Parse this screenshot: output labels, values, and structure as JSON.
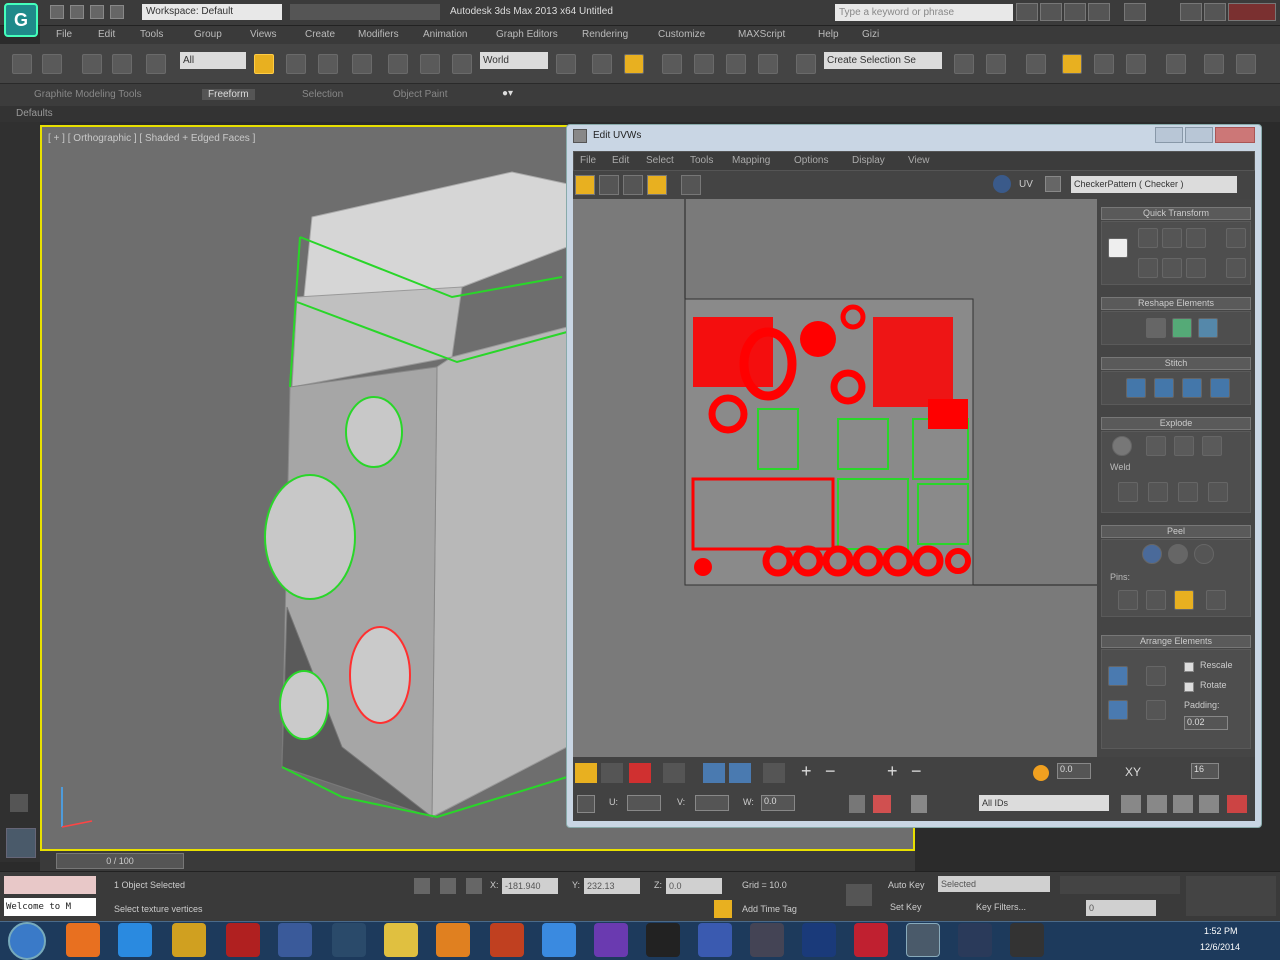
{
  "titlebar": {
    "workspace": "Workspace: Default",
    "title": "Autodesk 3ds Max  2013 x64      Untitled",
    "search_placeholder": "Type a keyword or phrase"
  },
  "menubar": [
    "File",
    "Edit",
    "Tools",
    "Group",
    "Views",
    "Create",
    "Modifiers",
    "Animation",
    "Graph Editors",
    "Rendering",
    "Customize",
    "MAXScript",
    "Help",
    "Gizi"
  ],
  "maintoolbar": {
    "filter": "All",
    "refcoord": "World",
    "selset": "Create Selection Se"
  },
  "ribbon": {
    "tabs": [
      "Graphite Modeling Tools",
      "Freeform",
      "Selection",
      "Object Paint"
    ],
    "defaults": "Defaults"
  },
  "viewport": {
    "label": "[ + ] [ Orthographic ] [ Shaded + Edged Faces ]"
  },
  "uvw": {
    "title": "Edit UVWs",
    "menus": [
      "File",
      "Edit",
      "Select",
      "Tools",
      "Mapping",
      "Options",
      "Display",
      "View"
    ],
    "uv_label": "UV",
    "pattern": "CheckerPattern  ( Checker )",
    "panels": {
      "quick": "Quick Transform",
      "reshape": "Reshape Elements",
      "stitch": "Stitch",
      "explode": "Explode",
      "weld": "Weld",
      "peel": "Peel",
      "pins": "Pins:",
      "arrange": "Arrange Elements",
      "rescale": "Rescale",
      "rotate": "Rotate",
      "padding": "Padding:",
      "padding_value": "0.02"
    },
    "bottom": {
      "value1": "0.0",
      "xy": "XY",
      "value2": "16",
      "u": "U:",
      "v": "V:",
      "w": "W:",
      "w_value": "0.0",
      "ids": "All IDs"
    }
  },
  "timeline": {
    "frame": "0 / 100"
  },
  "status": {
    "selected": "1 Object Selected",
    "prompt": "Select texture vertices",
    "x": "X:",
    "x_value": "-181.940",
    "y": "Y:",
    "y_value": "232.13",
    "z": "Z:",
    "z_value": "0.0",
    "grid": "Grid = 10.0",
    "tag": "Add Time Tag",
    "autokey": "Auto Key",
    "setkey": "Set Key",
    "mode": "Selected",
    "keyfilters": "Key Filters...",
    "frame_value": "0",
    "listener": "Welcome to M"
  },
  "taskbar": {
    "time": "1:52 PM",
    "date": "12/6/2014"
  },
  "colors": {
    "viewport_border": "#e8e000",
    "uv_islands": "#ff0000",
    "uv_green": "#29d629"
  }
}
